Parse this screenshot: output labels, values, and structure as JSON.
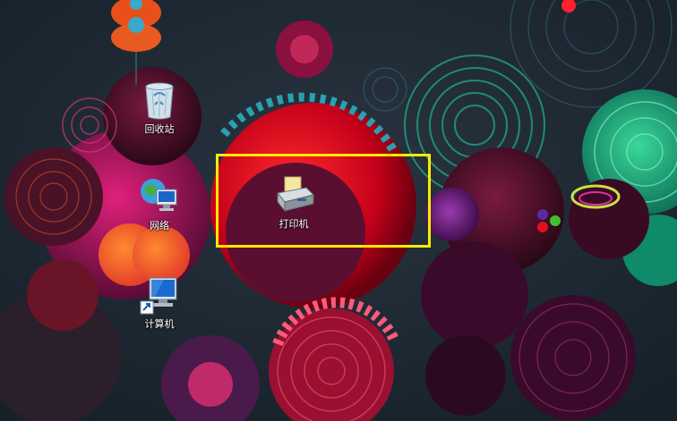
{
  "desktop": {
    "icons": [
      {
        "id": "recycle-bin",
        "label": "回收站",
        "icon": "recycle-bin-icon"
      },
      {
        "id": "network",
        "label": "网络",
        "icon": "network-icon"
      },
      {
        "id": "printer",
        "label": "打印机",
        "icon": "printer-icon"
      },
      {
        "id": "computer",
        "label": "计算机",
        "icon": "computer-icon"
      }
    ],
    "highlight_color": "#ffeb00"
  }
}
